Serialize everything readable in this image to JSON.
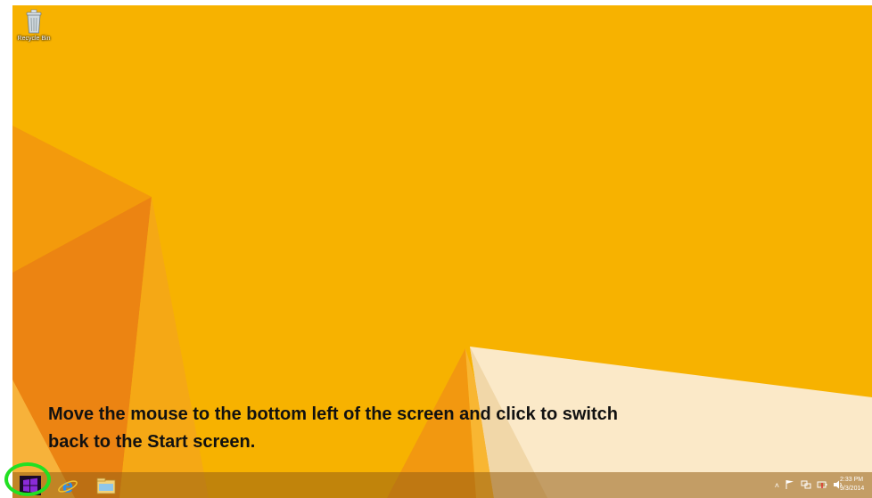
{
  "desktop": {
    "icons": [
      {
        "label": "Recycle Bin",
        "icon": "recycle-bin-icon"
      }
    ],
    "wallpaper_colors": {
      "base": "#f7b200",
      "orange": "#f08a10",
      "orange_dark": "#e27812",
      "light": "#fbe9c8",
      "light_shade": "#efd3a4"
    }
  },
  "instruction": {
    "line1": "Move the mouse to the bottom left of the screen and click to switch",
    "line2": "back to the Start screen."
  },
  "taskbar": {
    "start_icon": "windows-logo-icon",
    "pinned": [
      {
        "name": "Internet Explorer",
        "icon": "internet-explorer-icon"
      },
      {
        "name": "File Explorer",
        "icon": "file-explorer-icon"
      }
    ],
    "tray": {
      "chevron": "˄",
      "icons": [
        "action-center-flag-icon",
        "network-icon",
        "battery-icon",
        "volume-icon"
      ]
    },
    "clock": {
      "time": "2:33 PM",
      "date": "9/3/2014"
    }
  },
  "highlight_color": "#22e022"
}
